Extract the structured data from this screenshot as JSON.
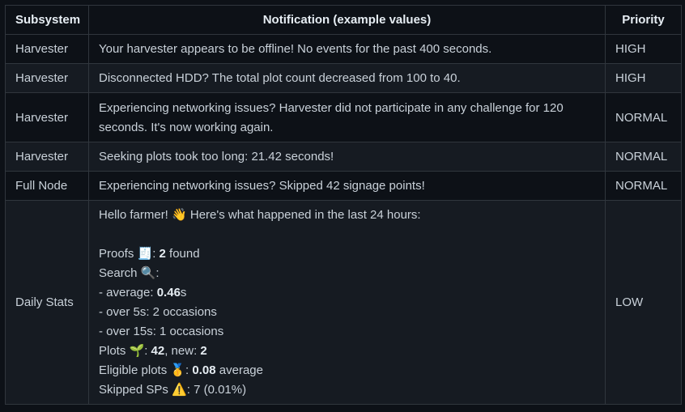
{
  "headers": {
    "subsystem": "Subsystem",
    "notification": "Notification (example values)",
    "priority": "Priority"
  },
  "rows": [
    {
      "subsystem": "Harvester",
      "notification": "Your harvester appears to be offline! No events for the past 400 seconds.",
      "priority": "HIGH"
    },
    {
      "subsystem": "Harvester",
      "notification": "Disconnected HDD? The total plot count decreased from 100 to 40.",
      "priority": "HIGH"
    },
    {
      "subsystem": "Harvester",
      "notification": "Experiencing networking issues? Harvester did not participate in any challenge for 120 seconds. It's now working again.",
      "priority": "NORMAL"
    },
    {
      "subsystem": "Harvester",
      "notification": "Seeking plots took too long: 21.42 seconds!",
      "priority": "NORMAL"
    },
    {
      "subsystem": "Full Node",
      "notification": "Experiencing networking issues? Skipped 42 signage points!",
      "priority": "NORMAL"
    }
  ],
  "daily_stats": {
    "subsystem": "Daily Stats",
    "priority": "LOW",
    "greeting": "Hello farmer! 👋 Here's what happened in the last 24 hours:",
    "proofs_label": "Proofs 🧾: ",
    "proofs_value": "2",
    "proofs_suffix": " found",
    "search_label": "Search 🔍:",
    "average_label": "- average: ",
    "average_value": "0.46",
    "average_unit": "s",
    "over5": "- over 5s: 2 occasions",
    "over15": "- over 15s: 1 occasions",
    "plots_label": "Plots 🌱: ",
    "plots_value": "42",
    "plots_new_label": ", new: ",
    "plots_new_value": "2",
    "eligible_label": "Eligible plots 🥇: ",
    "eligible_value": "0.08",
    "eligible_suffix": " average",
    "skipped": "Skipped SPs ⚠️: 7 (0.01%)"
  }
}
